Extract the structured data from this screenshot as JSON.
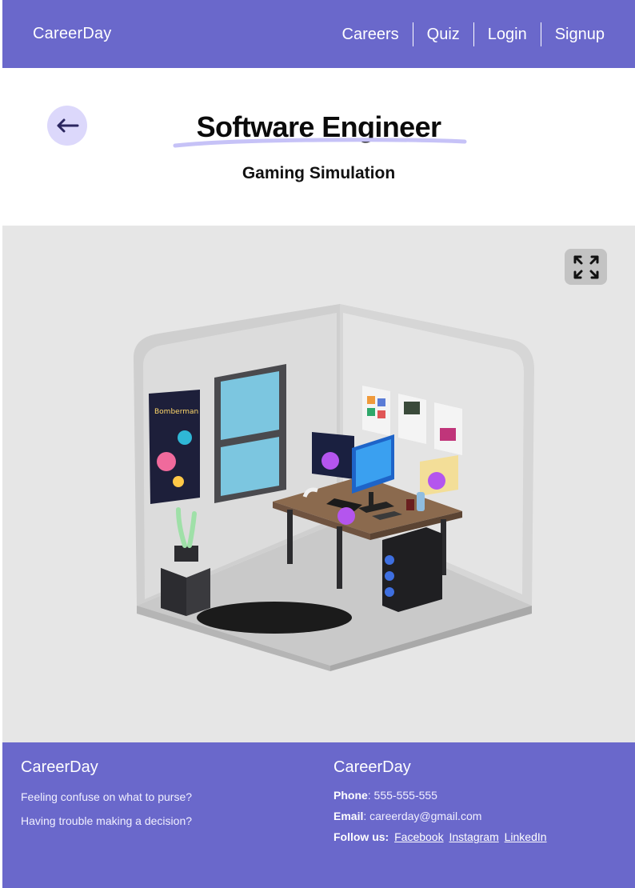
{
  "header": {
    "brand": "CareerDay",
    "nav": [
      {
        "label": "Careers"
      },
      {
        "label": "Quiz"
      },
      {
        "label": "Login"
      },
      {
        "label": "Signup"
      }
    ]
  },
  "page": {
    "title": "Software Engineer",
    "subtitle": "Gaming Simulation"
  },
  "simulation": {
    "poster_text": "Bomberman",
    "hotspot_count": 3,
    "hotspot_color": "#b455ee"
  },
  "footer": {
    "left": {
      "brand": "CareerDay",
      "text": "Feeling confuse on what to purse? Having trouble making a decision?"
    },
    "right": {
      "brand": "CareerDay",
      "phone_label": "Phone",
      "phone": ": 555-555-555",
      "email_label": "Email",
      "email": ": careerday@gmail.com",
      "follow_label": "Follow us:",
      "links": [
        "Facebook",
        "Instagram",
        "LinkedIn"
      ]
    }
  },
  "colors": {
    "accent": "#6a68cb",
    "back_button_bg": "#dcd8fb",
    "title_underline": "#c6c2f7"
  }
}
